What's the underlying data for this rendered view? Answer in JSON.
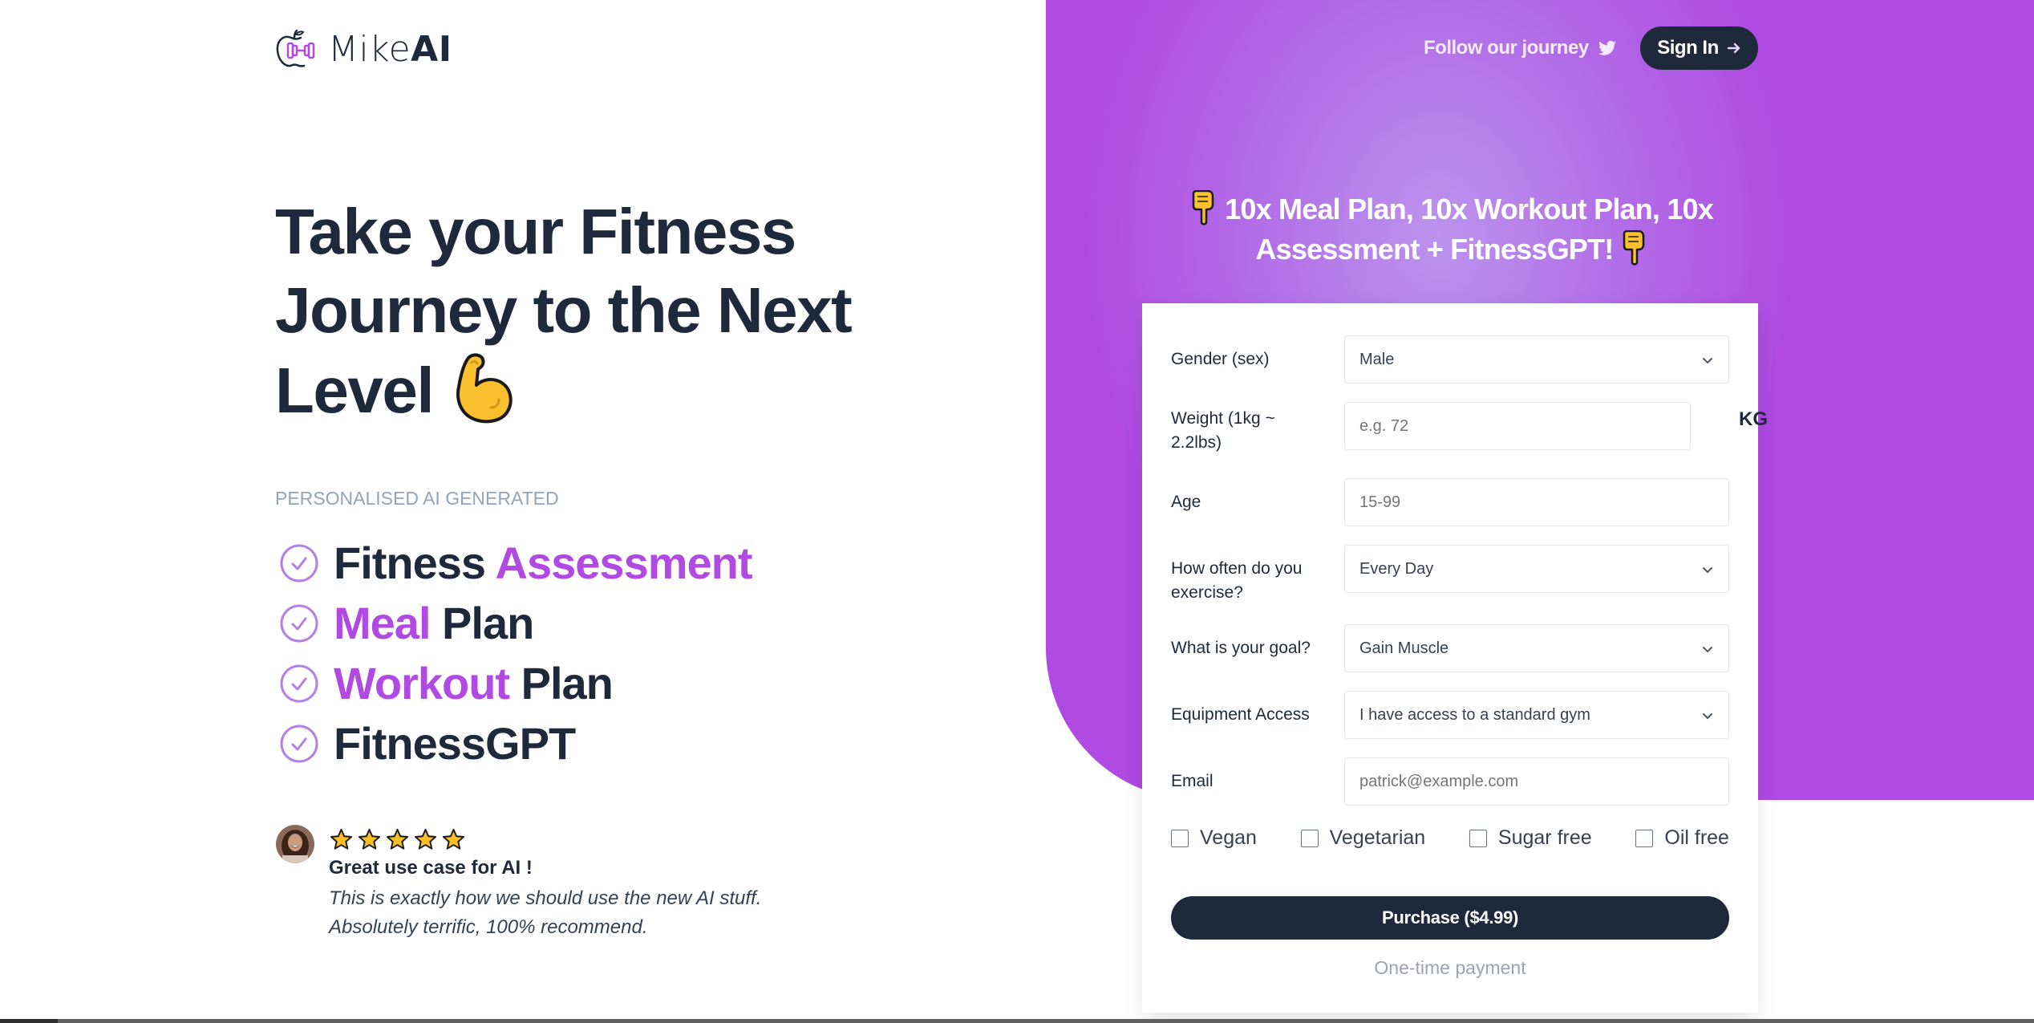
{
  "brand": {
    "name_light": "Mike",
    "name_bold": "AI",
    "logo_icon": "apple-dumbbell-icon"
  },
  "header": {
    "follow_label": "Follow our journey",
    "follow_icon": "twitter-icon",
    "signin_label": "Sign In",
    "signin_icon": "arrow-right-icon"
  },
  "hero": {
    "title": "Take your Fitness Journey to the Next Level",
    "title_icon": "flexed-biceps-icon",
    "subtitle": "PERSONALISED AI GENERATED",
    "features": [
      {
        "before": "Fitness ",
        "accent": "Assessment",
        "after": ""
      },
      {
        "before": "",
        "accent": "Meal",
        "after": " Plan"
      },
      {
        "before": "",
        "accent": "Workout",
        "after": " Plan"
      },
      {
        "before": "FitnessGPT",
        "accent": "",
        "after": ""
      }
    ]
  },
  "testimonial": {
    "rating": 5,
    "rating_max": 5,
    "title": "Great use case for AI !",
    "body": "This is exactly how we should use the new AI stuff. Absolutely terrific, 100% recommend."
  },
  "promo": {
    "text": "10x Meal Plan, 10x Workout Plan, 10x Assessment + FitnessGPT!",
    "icon": "backhand-index-pointing-down-icon"
  },
  "form": {
    "gender": {
      "label": "Gender (sex)",
      "value": "Male"
    },
    "weight": {
      "label": "Weight (1kg ~ 2.2lbs)",
      "placeholder": "e.g. 72",
      "unit": "KG"
    },
    "age": {
      "label": "Age",
      "placeholder": "15-99"
    },
    "frequency": {
      "label": "How often do you exercise?",
      "value": "Every Day"
    },
    "goal": {
      "label": "What is your goal?",
      "value": "Gain Muscle"
    },
    "equipment": {
      "label": "Equipment Access",
      "value": "I have access to a standard gym"
    },
    "email": {
      "label": "Email",
      "placeholder": "patrick@example.com"
    },
    "diet_options": [
      {
        "label": "Vegan",
        "checked": false
      },
      {
        "label": "Vegetarian",
        "checked": false
      },
      {
        "label": "Sugar free",
        "checked": false
      },
      {
        "label": "Oil free",
        "checked": false
      }
    ],
    "purchase_label": "Purchase ($4.99)",
    "payment_note": "One-time payment"
  },
  "colors": {
    "accent": "#b04ae2",
    "dark": "#1e293b",
    "muted": "#94a3b8"
  }
}
